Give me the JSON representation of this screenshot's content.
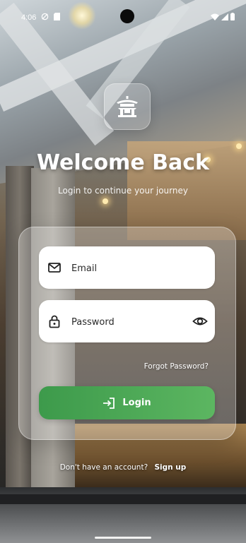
{
  "status_bar": {
    "time": "4:06",
    "icons": [
      "alarm-off-icon",
      "sim-icon",
      "wifi-icon",
      "signal-icon",
      "battery-icon"
    ]
  },
  "header": {
    "logo_icon": "pagoda-icon",
    "title": "Welcome Back",
    "subtitle": "Login to continue your journey"
  },
  "form": {
    "email": {
      "placeholder": "Email",
      "value": "",
      "icon": "mail-icon"
    },
    "password": {
      "placeholder": "Password",
      "value": "",
      "icon": "lock-icon",
      "toggle_icon": "eye-icon"
    },
    "forgot_label": "Forgot Password?",
    "login_label": "Login",
    "login_icon": "login-arrow-icon"
  },
  "footer": {
    "prompt": "Don't have an account?",
    "signup_label": "Sign up"
  },
  "colors": {
    "accent": "#4CAF50",
    "card": "rgba(255,255,255,0.28)",
    "text_on_bg": "#FFFFFF"
  }
}
